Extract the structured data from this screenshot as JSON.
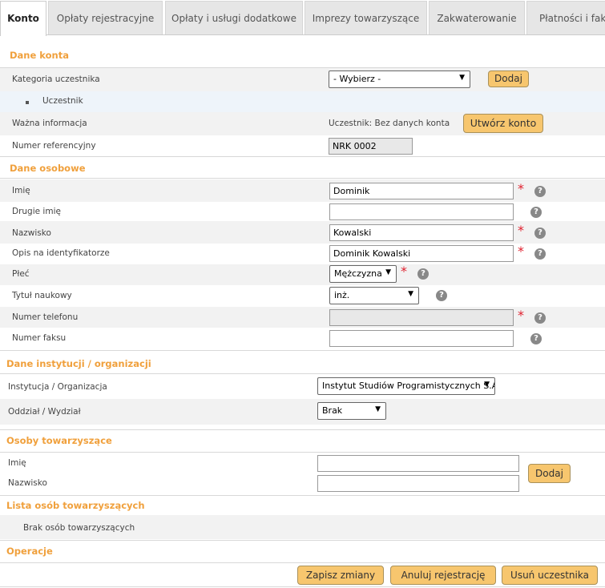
{
  "tabs": [
    "Konto",
    "Opłaty rejestracyjne",
    "Opłaty i usługi dodatkowe",
    "Imprezy towarzyszące",
    "Zakwaterowanie",
    "Płatności i faktury"
  ],
  "account": {
    "title": "Dane konta",
    "category_label": "Kategoria uczestnika",
    "category_select": "- Wybierz -",
    "add_button": "Dodaj",
    "category_item": "Uczestnik",
    "important_label": "Ważna informacja",
    "important_value": "Uczestnik: Bez danych konta",
    "create_account_button": "Utwórz konto",
    "reference_label": "Numer referencyjny",
    "reference_value": "NRK 0002"
  },
  "personal": {
    "title": "Dane osobowe",
    "first_name_label": "Imię",
    "first_name_value": "Dominik",
    "middle_name_label": "Drugie imię",
    "middle_name_value": "",
    "last_name_label": "Nazwisko",
    "last_name_value": "Kowalski",
    "badge_label": "Opis na identyfikatorze",
    "badge_value": "Dominik Kowalski",
    "gender_label": "Płeć",
    "gender_value": "Mężczyzna",
    "degree_label": "Tytuł naukowy",
    "degree_value": "inż.",
    "phone_label": "Numer telefonu",
    "phone_value": "",
    "fax_label": "Numer faksu",
    "fax_value": ""
  },
  "institution": {
    "title": "Dane instytucji / organizacji",
    "org_label": "Instytucja / Organizacja",
    "org_value": "Instytut Studiów Programistycznych S.A.",
    "dept_label": "Oddział / Wydział",
    "dept_value": "Brak"
  },
  "companions": {
    "title": "Osoby towarzyszące",
    "first_name_label": "Imię",
    "last_name_label": "Nazwisko",
    "add_button": "Dodaj"
  },
  "companion_list": {
    "title": "Lista osób towarzyszących",
    "empty_text": "Brak osób towarzyszących"
  },
  "operations": {
    "title": "Operacje",
    "save_button": "Zapisz zmiany",
    "cancel_registration_button": "Anuluj rejestrację",
    "delete_participant_button": "Usuń uczestnika"
  },
  "glyphs": {
    "required": "*",
    "help": "?",
    "caret": "▼"
  },
  "colors": {
    "section_title": "#f0a03c",
    "button_bg": "#f7c66e",
    "required": "#e0202e"
  }
}
